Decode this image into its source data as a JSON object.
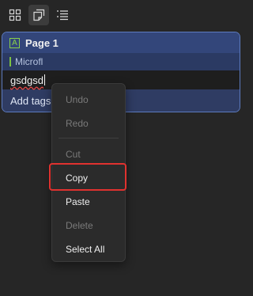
{
  "toolbar": {
    "buttons": [
      {
        "icon": "grid-icon"
      },
      {
        "icon": "pages-icon",
        "active": true
      },
      {
        "icon": "list-icon"
      }
    ]
  },
  "card": {
    "page_icon_glyph": "A",
    "title": "Page 1",
    "notebook_label": "Microfl",
    "edit_text": "gsdgsd",
    "tags_label": "Add tags"
  },
  "context_menu": {
    "items": [
      {
        "label": "Undo",
        "enabled": false
      },
      {
        "label": "Redo",
        "enabled": false
      },
      {
        "label": "Cut",
        "enabled": false
      },
      {
        "label": "Copy",
        "enabled": true,
        "highlighted": true
      },
      {
        "label": "Paste",
        "enabled": true
      },
      {
        "label": "Delete",
        "enabled": false
      },
      {
        "label": "Select All",
        "enabled": true
      }
    ]
  },
  "colors": {
    "background": "#262626",
    "card_border": "#5d7bbf",
    "header": "#33467a",
    "accent_green": "#8ad24a",
    "highlight_red": "#e0322f"
  }
}
